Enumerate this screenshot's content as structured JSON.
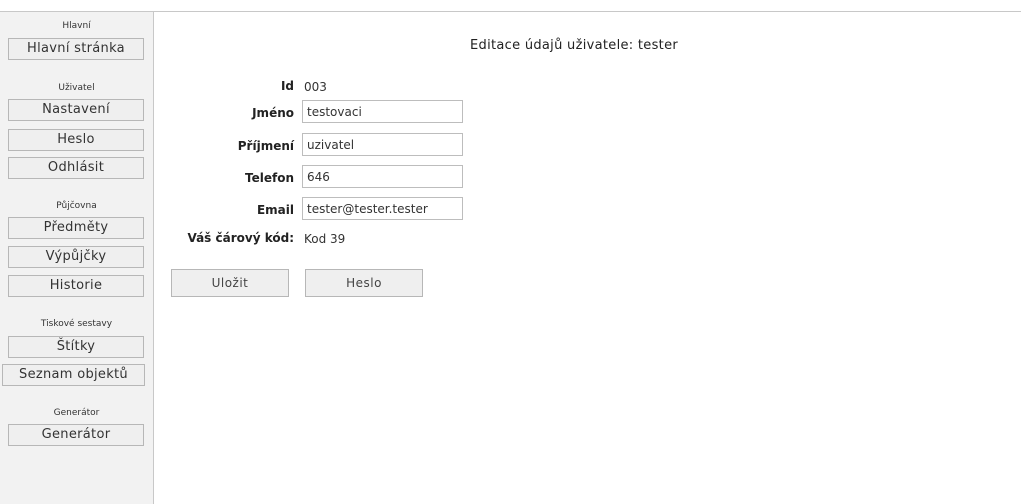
{
  "sidebar": {
    "sections": [
      {
        "title": "Hlavní",
        "items": [
          {
            "label": "Hlavní stránka"
          }
        ]
      },
      {
        "title": "Uživatel",
        "items": [
          {
            "label": "Nastavení"
          },
          {
            "label": "Heslo"
          },
          {
            "label": "Odhlásit"
          }
        ]
      },
      {
        "title": "Půjčovna",
        "items": [
          {
            "label": "Předměty"
          },
          {
            "label": "Výpůjčky"
          },
          {
            "label": "Historie"
          }
        ]
      },
      {
        "title": "Tiskové sestavy",
        "items": [
          {
            "label": "Štítky"
          },
          {
            "label": "Seznam objektů"
          }
        ]
      },
      {
        "title": "Generátor",
        "items": [
          {
            "label": "Generátor"
          }
        ]
      }
    ]
  },
  "main": {
    "title": "Editace údajů uživatele: tester",
    "form": {
      "id": {
        "label": "Id",
        "value": "003"
      },
      "first_name": {
        "label": "Jméno",
        "value": "testovaci"
      },
      "last_name": {
        "label": "Příjmení",
        "value": "uzivatel"
      },
      "phone": {
        "label": "Telefon",
        "value": "646"
      },
      "email": {
        "label": "Email",
        "value": "tester@tester.tester"
      },
      "barcode": {
        "label": "Váš čárový kód:",
        "value": "Kod 39"
      }
    },
    "buttons": {
      "save_label": "Uložit",
      "password_label": "Heslo"
    }
  }
}
